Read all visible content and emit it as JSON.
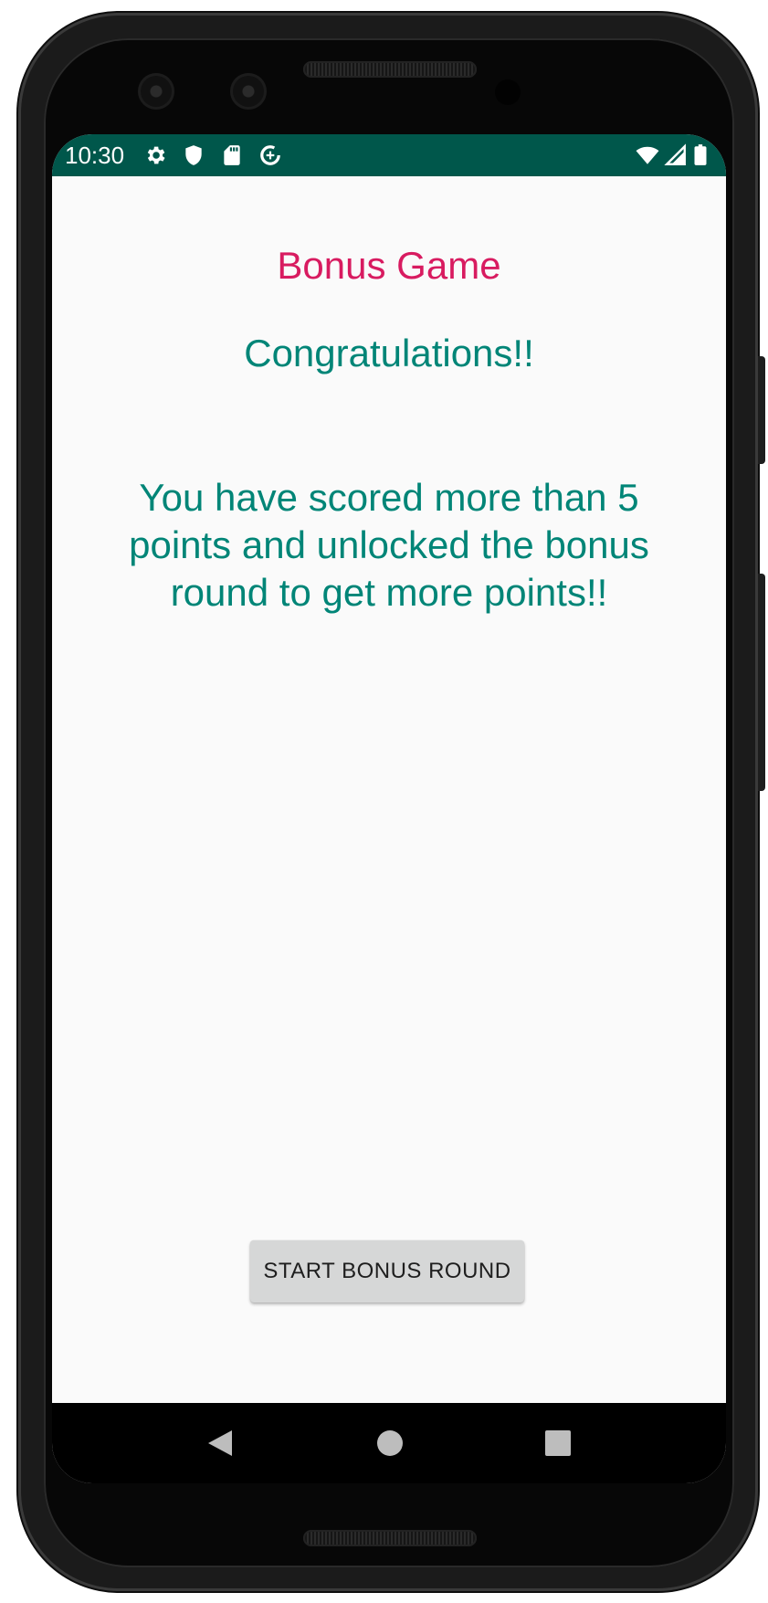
{
  "status_bar": {
    "time": "10:30",
    "left_icons": [
      "settings-icon",
      "shield-icon",
      "sd-card-icon",
      "data-saver-icon"
    ],
    "right_icons": [
      "wifi-icon",
      "cell-signal-icon",
      "battery-icon"
    ],
    "background_color": "#00574b"
  },
  "screen": {
    "title": "Bonus Game",
    "congrats": "Congratulations!!",
    "message": "You have scored more than 5 points and unlocked the bonus round to get more points!!",
    "start_button_label": "START BONUS ROUND"
  },
  "navigation_bar": {
    "buttons": [
      "back-icon",
      "home-icon",
      "recents-icon"
    ]
  },
  "colors": {
    "title": "#d81b60",
    "body_text": "#008577",
    "button_bg": "#d6d7d7"
  }
}
